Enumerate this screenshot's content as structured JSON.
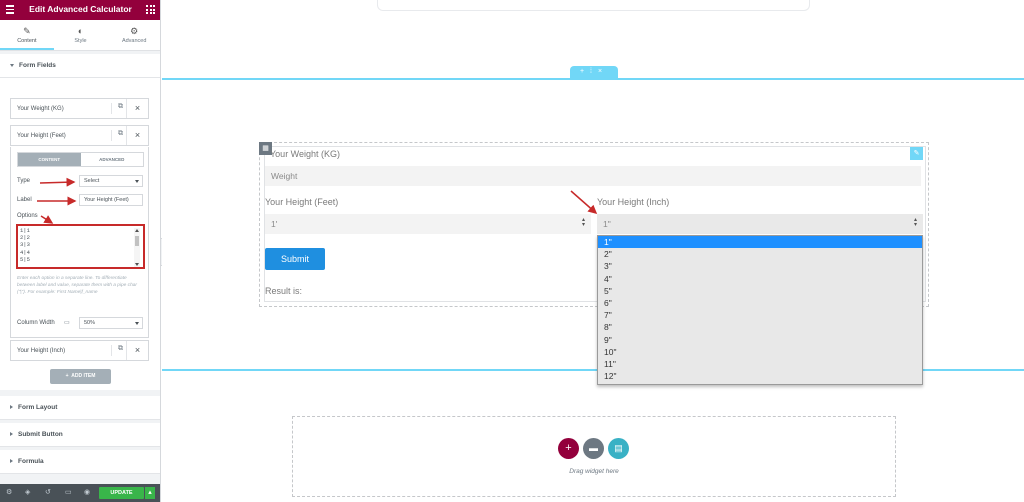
{
  "panel": {
    "title": "Edit Advanced Calculator",
    "tabs": [
      {
        "label": "Content",
        "icon": "pencil-icon"
      },
      {
        "label": "Style",
        "icon": "half-circle-icon"
      },
      {
        "label": "Advanced",
        "icon": "gear-icon"
      }
    ],
    "sections": {
      "form_fields": "Form Fields",
      "form_layout": "Form Layout",
      "submit_button": "Submit Button",
      "formula": "Formula"
    },
    "items": [
      {
        "label": "Your Weight (KG)"
      },
      {
        "label": "Your Height (Feet)"
      },
      {
        "label": "Your Height (Inch)"
      }
    ],
    "editor": {
      "tab_content": "CONTENT",
      "tab_advanced": "ADVANCED",
      "type_label": "Type",
      "type_value": "Select",
      "label_label": "Label",
      "label_value": "Your Height (Feet)",
      "options_label": "Options",
      "options": [
        "1|1",
        "2|2",
        "3|3",
        "4|4",
        "5|5"
      ],
      "help_text": "Enter each option in a separate line. To differentiate between label and value, separate them with a pipe char (\"|\"). For example: First Name|f_name",
      "column_width_label": "Column Width",
      "column_width_value": "50%"
    },
    "add_item": "ADD ITEM",
    "update": "UPDATE"
  },
  "form": {
    "weight_label": "Your Weight (KG)",
    "weight_placeholder": "Weight",
    "feet_label": "Your Height (Feet)",
    "feet_value": "1'",
    "inch_label": "Your Height (Inch)",
    "inch_value": "1\"",
    "submit": "Submit",
    "result": "Result is:"
  },
  "dropdown": {
    "options": [
      "1\"",
      "2\"",
      "3\"",
      "4\"",
      "5\"",
      "6\"",
      "7\"",
      "8\"",
      "9\"",
      "10\"",
      "11\"",
      "12\""
    ],
    "selected_index": 0
  },
  "empty_section": {
    "text": "Drag widget here",
    "buttons": [
      {
        "icon": "plus-icon",
        "color": "#93003c"
      },
      {
        "icon": "folder-icon",
        "color": "#6d7882"
      },
      {
        "icon": "template-icon",
        "color": "#39b1c5"
      }
    ]
  },
  "colors": {
    "brand": "#93003c",
    "accent": "#71d7f7",
    "update": "#39b54a",
    "submit": "#1f8fe0",
    "annotation_arrow": "#c72a2a"
  }
}
